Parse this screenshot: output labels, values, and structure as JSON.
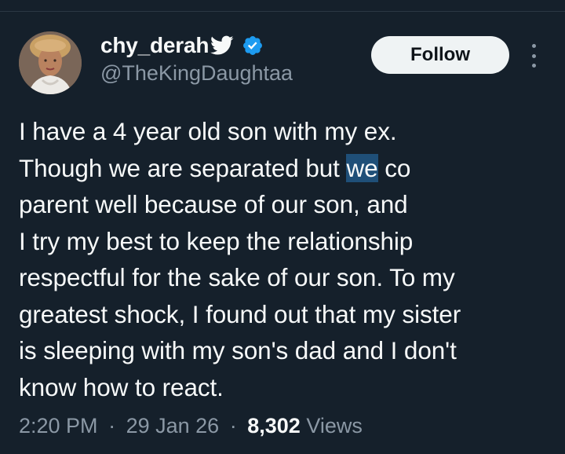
{
  "author": {
    "display_name": "chy_derah",
    "handle": "@TheKingDaughtaa",
    "badge_icon": "bird-icon",
    "verified_icon": "verified-badge-icon",
    "verified_color": "#1d9bf0"
  },
  "actions": {
    "follow_label": "Follow",
    "more_icon": "more-vertical-icon"
  },
  "tweet": {
    "lines": [
      "I have a 4 year old son with my ex.",
      "Though we are separated but ",
      "we",
      " co",
      "parent well because of our son, and",
      "I try my best to keep the relationship",
      "respectful for the sake of our son. To my",
      "greatest shock, I found out that my sister",
      "is sleeping with my son's dad and I don't",
      "know how to react."
    ]
  },
  "meta": {
    "time": "2:20 PM",
    "date": "29 Jan 26",
    "separator": "·",
    "views_count": "8,302",
    "views_label": "Views"
  },
  "colors": {
    "background": "#15202b",
    "text": "#f7f9f9",
    "secondary_text": "#8b98a5",
    "highlight": "#1f4f78"
  }
}
